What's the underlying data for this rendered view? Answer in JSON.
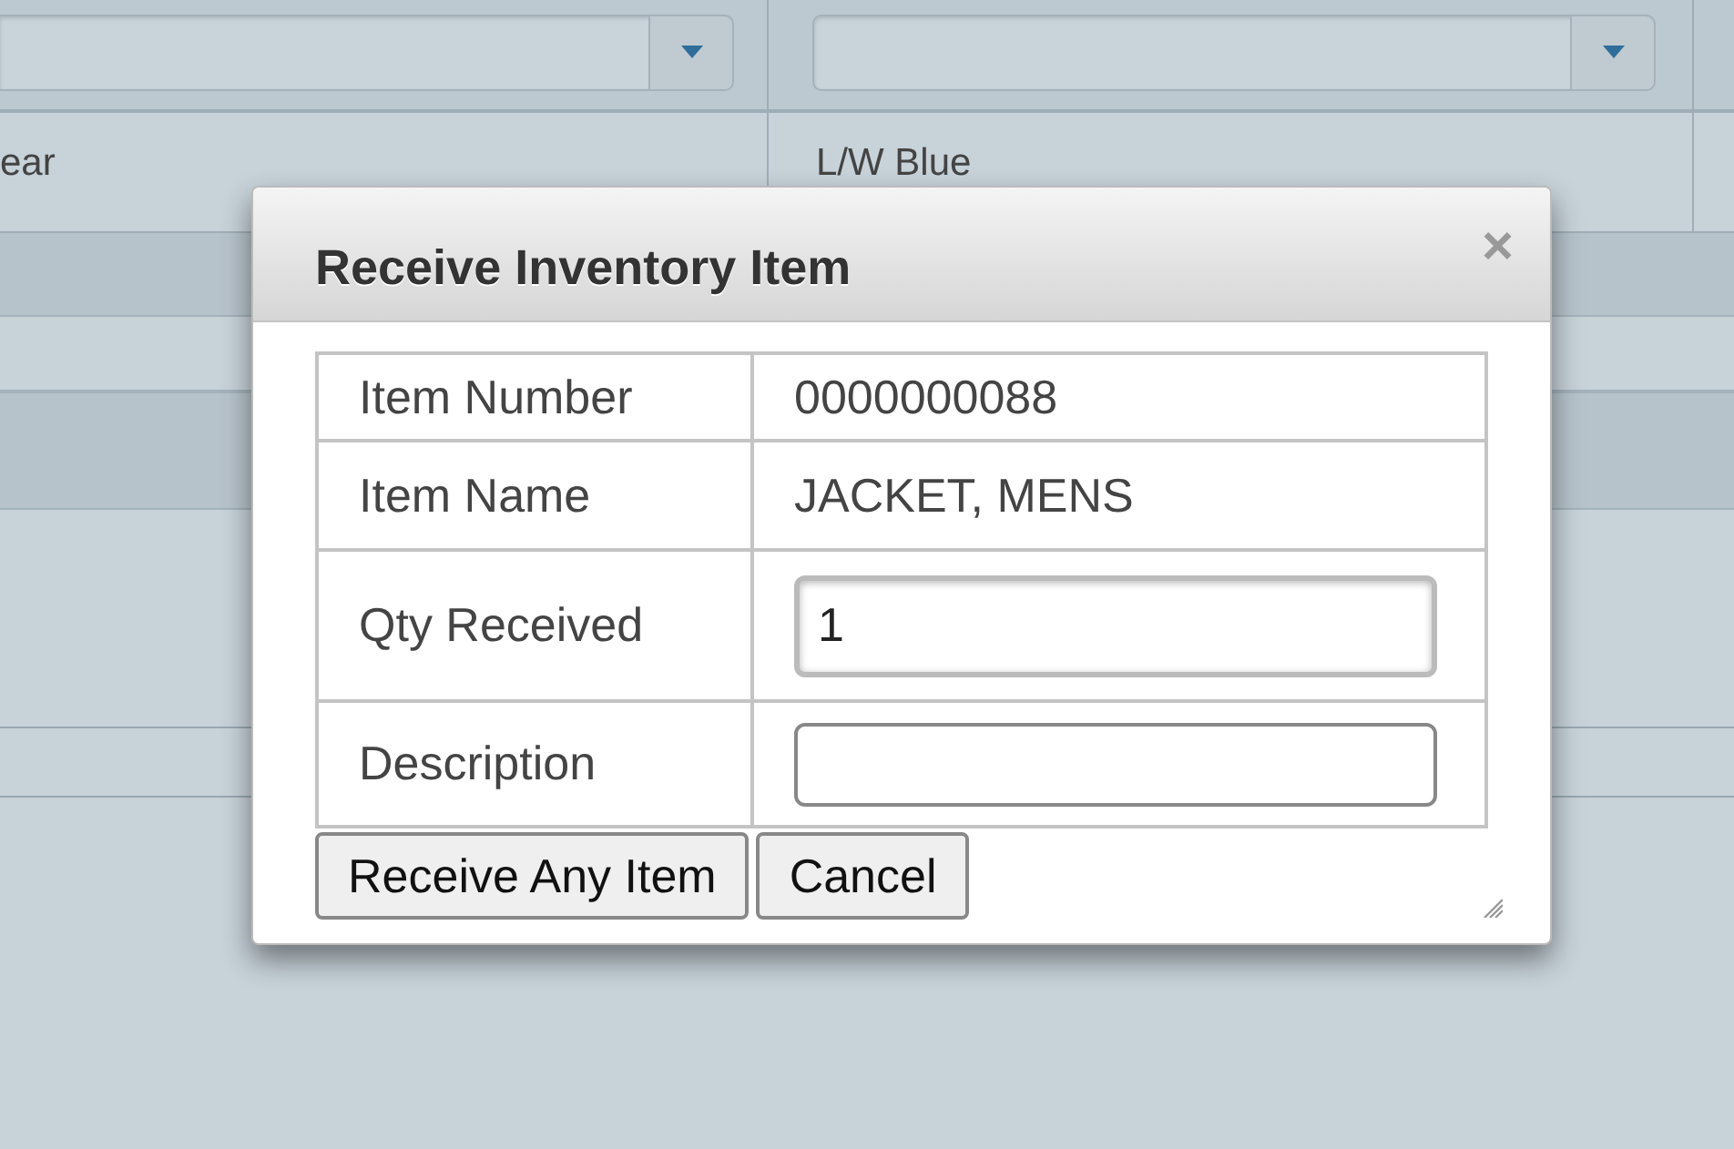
{
  "background": {
    "dropdowns": [
      {
        "kind": "select"
      },
      {
        "kind": "select"
      }
    ],
    "row_cells": [
      "ear",
      "L/W Blue"
    ]
  },
  "dialog": {
    "title": "Receive Inventory Item",
    "close": "×",
    "fields": [
      {
        "kind": "text",
        "label": "Item Number",
        "value": "0000000088"
      },
      {
        "kind": "text",
        "label": "Item Name",
        "value": "JACKET, MENS"
      },
      {
        "kind": "input",
        "label": "Qty Received",
        "value": "1",
        "focused": true
      },
      {
        "kind": "input",
        "label": "Description",
        "focused": false
      }
    ],
    "buttons": [
      "Receive Any Item",
      "Cancel"
    ]
  }
}
